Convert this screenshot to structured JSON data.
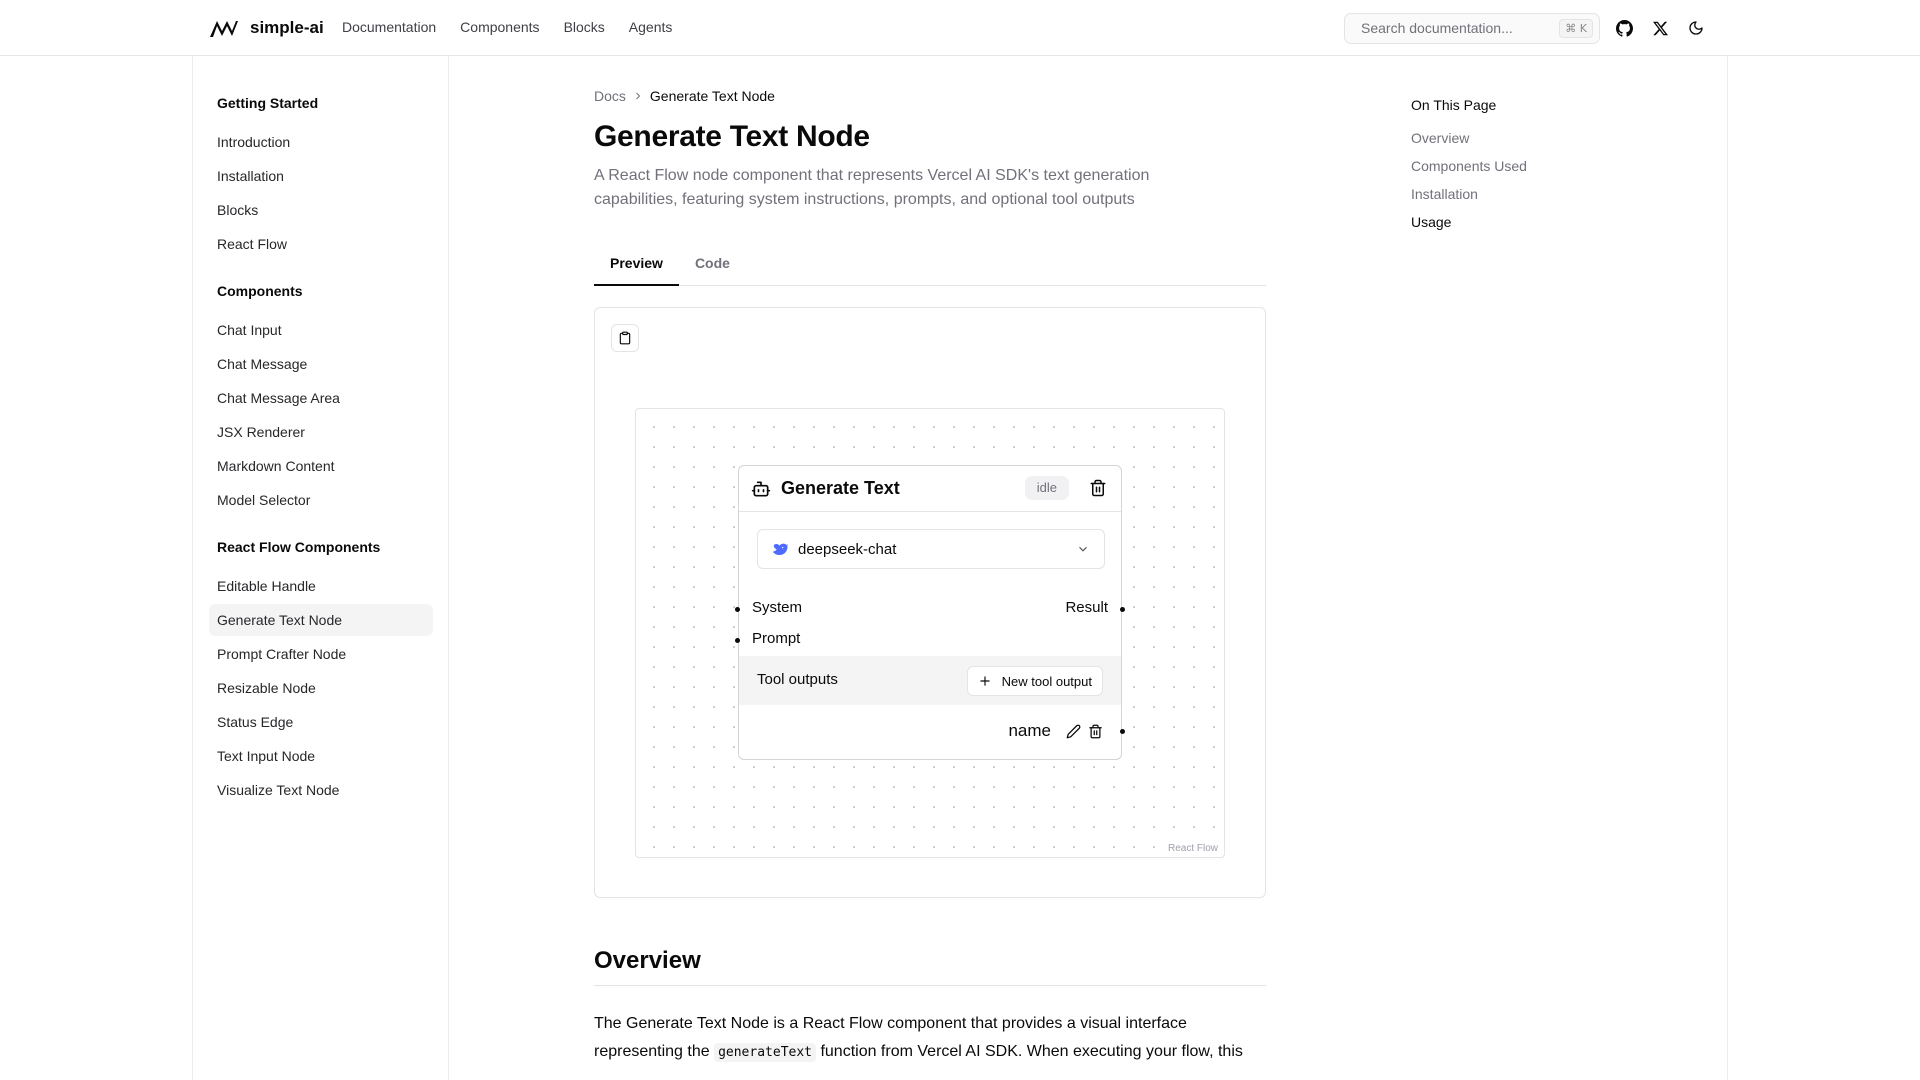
{
  "header": {
    "brand": "simple-ai",
    "nav": [
      "Documentation",
      "Components",
      "Blocks",
      "Agents"
    ],
    "search_placeholder": "Search documentation...",
    "search_shortcut": "⌘ K",
    "icons": [
      "github-icon",
      "x-icon",
      "moon-icon"
    ]
  },
  "sidebar": {
    "groups": [
      {
        "heading": "Getting Started",
        "items": [
          "Introduction",
          "Installation",
          "Blocks",
          "React Flow"
        ]
      },
      {
        "heading": "Components",
        "items": [
          "Chat Input",
          "Chat Message",
          "Chat Message Area",
          "JSX Renderer",
          "Markdown Content",
          "Model Selector"
        ]
      },
      {
        "heading": "React Flow Components",
        "items": [
          "Editable Handle",
          "Generate Text Node",
          "Prompt Crafter Node",
          "Resizable Node",
          "Status Edge",
          "Text Input Node",
          "Visualize Text Node"
        ]
      }
    ],
    "active_item": "Generate Text Node"
  },
  "main": {
    "breadcrumb": {
      "root": "Docs",
      "current": "Generate Text Node"
    },
    "title": "Generate Text Node",
    "description": "A React Flow node component that represents Vercel AI SDK's text generation capabilities, featuring system instructions, prompts, and optional tool outputs",
    "tabs": [
      {
        "label": "Preview",
        "active": true
      },
      {
        "label": "Code",
        "active": false
      }
    ],
    "preview": {
      "attribution": "React Flow",
      "node": {
        "title": "Generate Text",
        "status": "idle",
        "model": "deepseek-chat",
        "inputs": [
          "System",
          "Prompt"
        ],
        "output": "Result",
        "tool_outputs_label": "Tool outputs",
        "new_tool_button": "New tool output",
        "tools": [
          "name"
        ]
      }
    },
    "overview": {
      "title": "Overview",
      "text_before": "The Generate Text Node is a React Flow component that provides a visual interface representing the ",
      "code": "generateText",
      "text_after": " function from Vercel AI SDK. When executing your flow, this"
    }
  },
  "toc": {
    "heading": "On This Page",
    "items": [
      "Overview",
      "Components Used",
      "Installation",
      "Usage"
    ],
    "active": "Usage"
  },
  "colors": {
    "accent": "#0a0a0a",
    "muted": "#71717a",
    "border": "#e4e4e7",
    "deepseek": "#4d6bfe"
  }
}
